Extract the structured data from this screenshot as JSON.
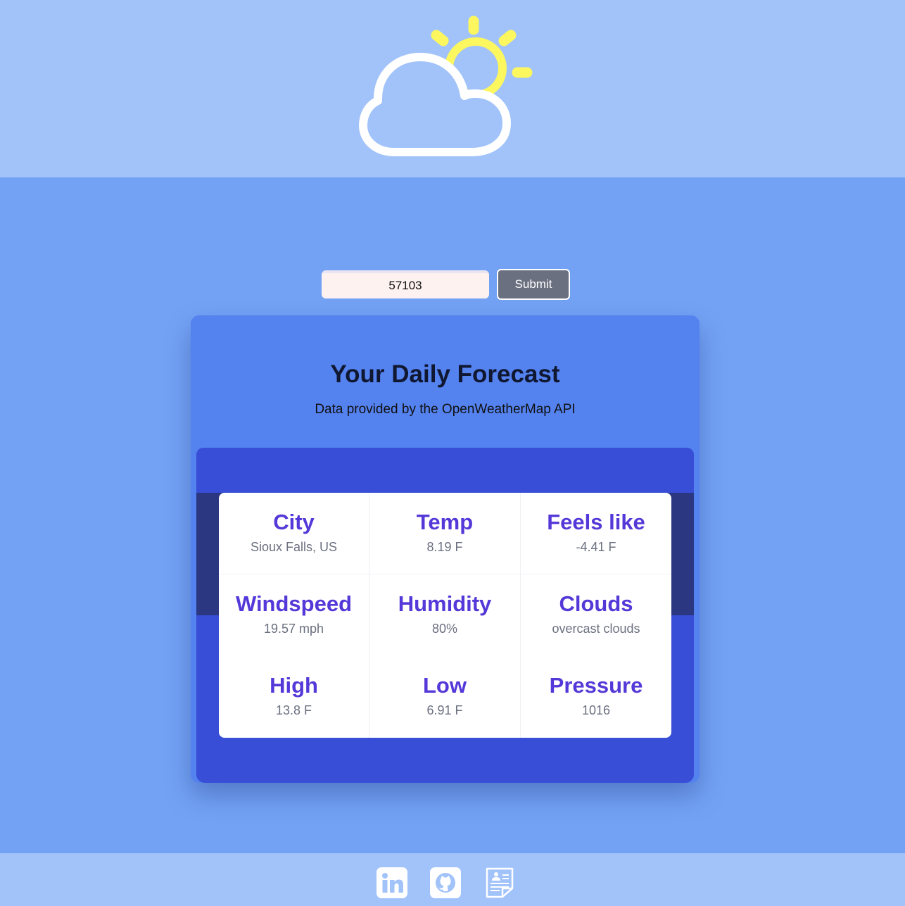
{
  "search": {
    "zip_value": "57103",
    "submit_label": "Submit"
  },
  "forecast": {
    "title": "Your Daily Forecast",
    "subtitle": "Data provided by the OpenWeatherMap API",
    "stats": [
      {
        "label": "City",
        "value": "Sioux Falls, US"
      },
      {
        "label": "Temp",
        "value": "8.19 F"
      },
      {
        "label": "Feels like",
        "value": "-4.41 F"
      },
      {
        "label": "Windspeed",
        "value": "19.57 mph"
      },
      {
        "label": "Humidity",
        "value": "80%"
      },
      {
        "label": "Clouds",
        "value": "overcast clouds"
      },
      {
        "label": "High",
        "value": "13.8 F"
      },
      {
        "label": "Low",
        "value": "6.91 F"
      },
      {
        "label": "Pressure",
        "value": "1016"
      }
    ]
  },
  "header": {
    "logo_icon": "partly-cloudy-icon"
  },
  "footer": {
    "icons": [
      "linkedin-icon",
      "github-icon",
      "resume-icon"
    ]
  },
  "colors": {
    "header_bg": "#a1c3fa",
    "page_bg": "#73a2f5",
    "card_bg": "#5482ef",
    "panel_bg": "#384ed6",
    "label_purple": "#5438d8",
    "sun_yellow": "#fcf75e"
  }
}
